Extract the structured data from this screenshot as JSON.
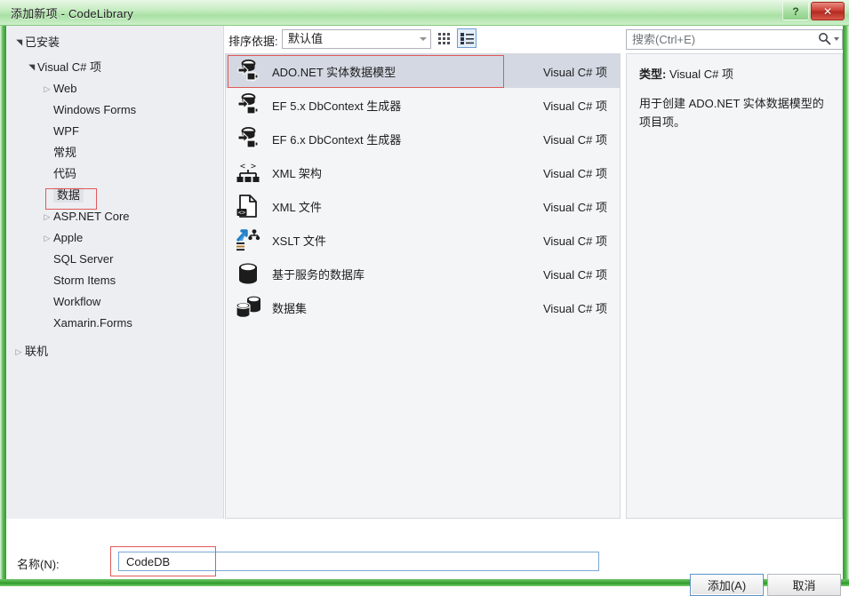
{
  "window": {
    "title": "添加新项 - CodeLibrary",
    "help_button": "?",
    "close_button": "✕",
    "frame_color": "#3fae3a"
  },
  "tree": {
    "root_label": "已安装",
    "items": [
      {
        "label": "已安装",
        "level": 0,
        "arrow": "open",
        "selected": false
      },
      {
        "label": "Visual C# 项",
        "level": 1,
        "arrow": "open",
        "selected": false
      },
      {
        "label": "Web",
        "level": 2,
        "arrow": "closed",
        "selected": false
      },
      {
        "label": "Windows Forms",
        "level": 2,
        "arrow": "none",
        "selected": false
      },
      {
        "label": "WPF",
        "level": 2,
        "arrow": "none",
        "selected": false
      },
      {
        "label": "常规",
        "level": 2,
        "arrow": "none",
        "selected": false
      },
      {
        "label": "代码",
        "level": 2,
        "arrow": "none",
        "selected": false
      },
      {
        "label": "数据",
        "level": 2,
        "arrow": "none",
        "selected": true
      },
      {
        "label": "ASP.NET Core",
        "level": 2,
        "arrow": "closed",
        "selected": false
      },
      {
        "label": "Apple",
        "level": 2,
        "arrow": "closed",
        "selected": false
      },
      {
        "label": "SQL Server",
        "level": 2,
        "arrow": "none",
        "selected": false
      },
      {
        "label": "Storm Items",
        "level": 2,
        "arrow": "none",
        "selected": false
      },
      {
        "label": "Workflow",
        "level": 2,
        "arrow": "none",
        "selected": false
      },
      {
        "label": "Xamarin.Forms",
        "level": 2,
        "arrow": "none",
        "selected": false
      },
      {
        "label": "联机",
        "level": 0,
        "arrow": "closed",
        "selected": false
      }
    ]
  },
  "toolbar": {
    "sort_label": "排序依据:",
    "sort_value": "默认值",
    "view_tiles_name": "tiles-view",
    "view_list_name": "list-view",
    "view_selected": "list"
  },
  "search": {
    "placeholder": "搜索(Ctrl+E)",
    "value": ""
  },
  "list": {
    "kind_common": "Visual C# 项",
    "items": [
      {
        "name": "ADO.NET 实体数据模型",
        "kind": "Visual C# 项",
        "icon": "ef-model-icon",
        "selected": true
      },
      {
        "name": "EF 5.x DbContext 生成器",
        "kind": "Visual C# 项",
        "icon": "ef-model-icon",
        "selected": false
      },
      {
        "name": "EF 6.x DbContext 生成器",
        "kind": "Visual C# 项",
        "icon": "ef-model-icon",
        "selected": false
      },
      {
        "name": "XML 架构",
        "kind": "Visual C# 项",
        "icon": "xml-schema-icon",
        "selected": false
      },
      {
        "name": "XML 文件",
        "kind": "Visual C# 项",
        "icon": "xml-file-icon",
        "selected": false
      },
      {
        "name": "XSLT 文件",
        "kind": "Visual C# 项",
        "icon": "xslt-file-icon",
        "selected": false
      },
      {
        "name": "基于服务的数据库",
        "kind": "Visual C# 项",
        "icon": "database-icon",
        "selected": false
      },
      {
        "name": "数据集",
        "kind": "Visual C# 项",
        "icon": "dataset-icon",
        "selected": false
      }
    ]
  },
  "detail": {
    "type_label": "类型:",
    "type_value": "Visual C# 项",
    "description": "用于创建 ADO.NET 实体数据模型的项目项。"
  },
  "bottom": {
    "name_label": "名称(N):",
    "name_value": "CodeDB",
    "add_button": "添加(A)",
    "cancel_button": "取消"
  },
  "annotations": {
    "accent_color": "#e05a5a",
    "targets": [
      "数据",
      "ADO.NET 实体数据模型",
      "CodeDB"
    ]
  }
}
